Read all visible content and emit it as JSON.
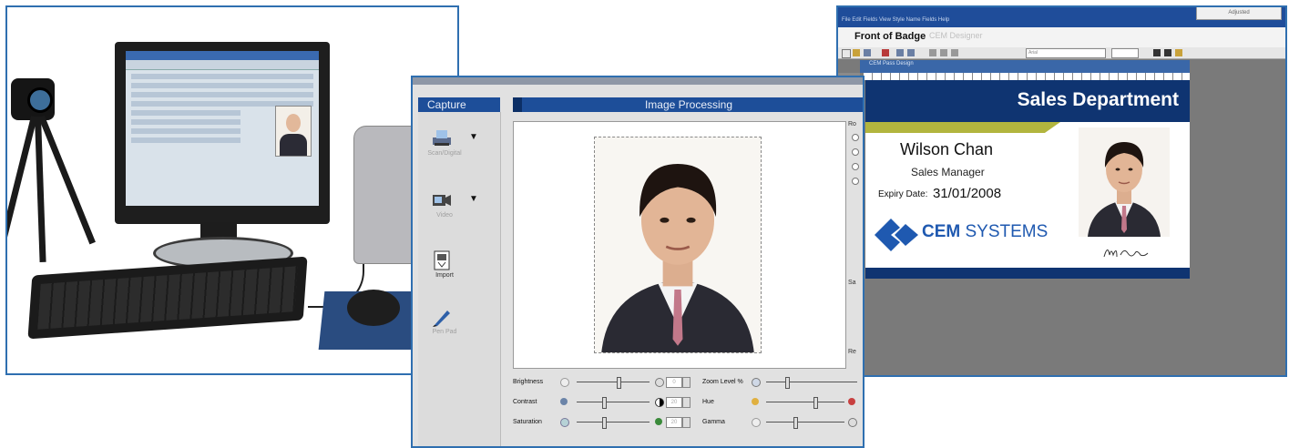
{
  "designer": {
    "title": "Front of Badge",
    "tab": "CEM Designer",
    "menu": "File  Edit  Fields  View  Style  Name Fields  Help",
    "inner_title": "CEM Pass Design",
    "font_name": "Arial",
    "top_right": "Adjusted"
  },
  "badge": {
    "department": "Sales Department",
    "name": "Wilson Chan",
    "role": "Sales Manager",
    "expiry_label": "Expiry Date:",
    "expiry_value": "31/01/2008",
    "logo_bold": "CEM",
    "logo_rest": " SYSTEMS",
    "colors": {
      "navy": "#0f3471",
      "stripe": "#b2b53e",
      "logo": "#1f59b0"
    }
  },
  "capture": {
    "left_header": "Capture",
    "main_header": "Image Processing",
    "tools": [
      {
        "label": "Scan/Digital",
        "icon": "scanner-icon"
      },
      {
        "label": "Video",
        "icon": "video-camera-icon"
      },
      {
        "label": "Import",
        "icon": "import-icon"
      },
      {
        "label": "Pen Pad",
        "icon": "pen-icon"
      }
    ],
    "right_labels": {
      "r1": "Ro",
      "r2": "Sa",
      "r3": "Re"
    },
    "sliders": {
      "brightness": {
        "label": "Brightness",
        "value": "0",
        "level": 0.55
      },
      "contrast": {
        "label": "Contrast",
        "value": "20",
        "level": 0.35
      },
      "saturation": {
        "label": "Saturation",
        "value": "20",
        "level": 0.35
      },
      "zoom": {
        "label": "Zoom Level %",
        "level": 0.35
      },
      "hue": {
        "label": "Hue",
        "level": 0.6
      },
      "gamma": {
        "label": "Gamma",
        "level": 0.35
      }
    }
  }
}
